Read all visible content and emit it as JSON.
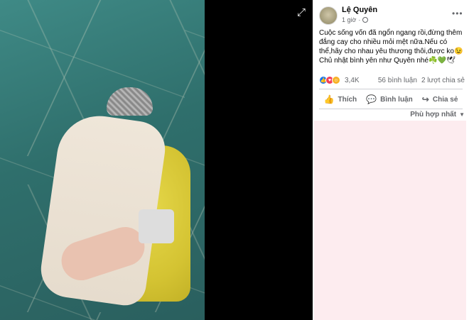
{
  "post": {
    "author": "Lệ Quyên",
    "time": "1 giờ",
    "text": "Cuộc sống vốn đã ngổn ngang rồi,đừng thêm đắng cay cho nhiều mỏi mệt nữa.Nếu có thể,hãy cho nhau yêu thương thôi,được ko😉 Chủ nhật bình yên như Quyên nhé☘️💚🕊",
    "more": "•••"
  },
  "reactions": {
    "count": "3,4K",
    "icons": [
      "like-icon",
      "love-icon",
      "care-icon"
    ],
    "comments": "56 bình luận",
    "shares": "2 lượt chia sẻ"
  },
  "actions": {
    "like": "Thích",
    "comment": "Bình luận",
    "share": "Chia sẻ"
  },
  "sort": {
    "label": "Phù hợp nhất"
  },
  "colors": {
    "accent": "#1877f2",
    "text_secondary": "#65676b",
    "comments_bg": "#fdecef"
  }
}
